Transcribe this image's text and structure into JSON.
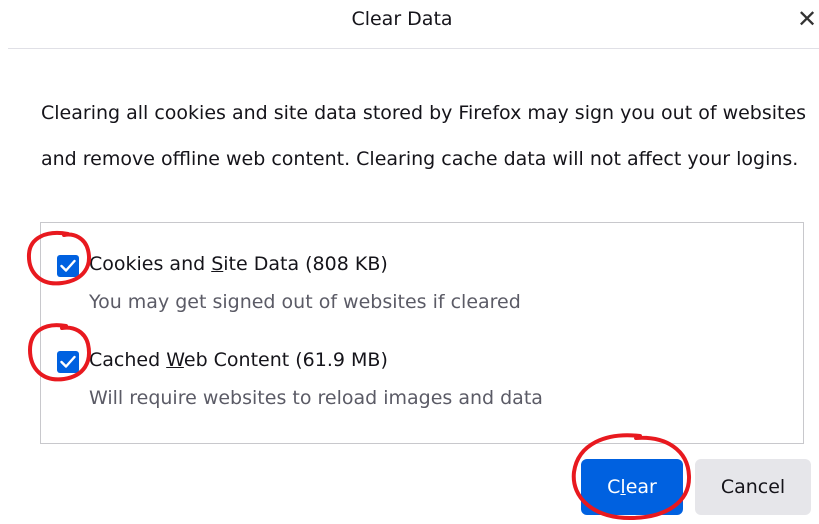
{
  "dialog": {
    "title": "Clear Data",
    "close_glyph": "✕",
    "description": "Clearing all cookies and site data stored by Firefox may sign you out of websites and remove offline web content. Clearing cache data will not affect your logins."
  },
  "options": [
    {
      "label_pre": "Cookies and ",
      "label_key": "S",
      "label_post": "ite Data (808 KB)",
      "hint": "You may get signed out of websites if cleared",
      "checked": true
    },
    {
      "label_pre": "Cached ",
      "label_key": "W",
      "label_post": "eb Content (61.9 MB)",
      "hint": "Will require websites to reload images and data",
      "checked": true
    }
  ],
  "buttons": {
    "clear_pre": "C",
    "clear_key": "l",
    "clear_post": "ear",
    "cancel": "Cancel"
  },
  "colors": {
    "accent": "#0061e0",
    "annotation": "#e8191f",
    "secondary_button": "#e6e6ea"
  },
  "icons": {
    "close": "close-icon",
    "check": "checkmark-icon"
  }
}
